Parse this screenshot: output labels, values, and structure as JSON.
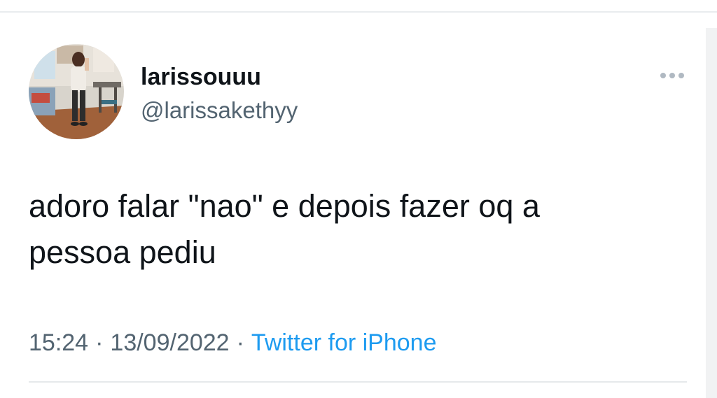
{
  "author": {
    "display_name": "larissouuu",
    "handle": "@larissakethyy"
  },
  "tweet": {
    "text": "adoro falar \"nao\" e depois fazer oq a\npessoa pediu",
    "time": "15:24",
    "separator": "·",
    "date": "13/09/2022",
    "source": "Twitter for iPhone"
  },
  "icons": {
    "more": "more-horizontal-icon",
    "avatar": "profile-photo"
  },
  "colors": {
    "text_primary": "#0f1419",
    "text_secondary": "#536471",
    "link": "#1d9bf0",
    "divider": "#e6e9eb"
  }
}
